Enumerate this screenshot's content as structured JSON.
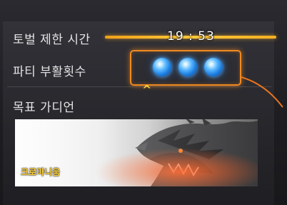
{
  "hud": {
    "time_limit_label": "토벌 제한 시간",
    "timer_value": "19 : 53",
    "revive_label": "파티 부활횟수",
    "revive_count": 3,
    "target_guardian_label": "목표 가디언",
    "guardian_name": "크로마니움"
  },
  "icons": {
    "revive_orb": "revive-orb-icon",
    "caret": "caret-up-icon"
  },
  "colors": {
    "timer_bar": "#f5b022",
    "highlight": "#f08a22",
    "orb": "#2f8fff",
    "guardian_name": "#ffd23a"
  }
}
